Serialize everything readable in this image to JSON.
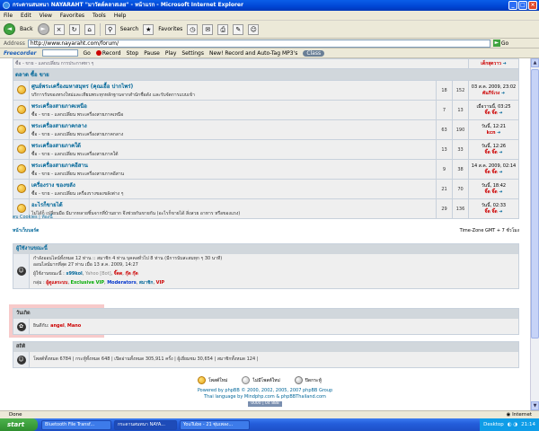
{
  "window": {
    "title": "กระดานสนทนา NAYARAHT \"มาวัตต์คลาสเลย\" - หน้าแรก - Microsoft Internet Explorer",
    "buttons": [
      "_",
      "□",
      "×"
    ]
  },
  "menu": [
    "File",
    "Edit",
    "View",
    "Favorites",
    "Tools",
    "Help"
  ],
  "toolbar": {
    "back": "Back",
    "search": "Search",
    "favorites": "Favorites"
  },
  "address": {
    "label": "Address",
    "url": "http://www.nayaraht.com/forum/",
    "go": "Go"
  },
  "linksbar": {
    "brand": "Freecorder",
    "go": "Go",
    "record": "Record",
    "stop": "Stop",
    "pause": "Pause",
    "play": "Play",
    "settings": "Settings",
    "new_record": "New! Record and Auto-Tag MP3's",
    "class_label": "Class"
  },
  "forum": {
    "cut_row": "ซื้อ - ขาย - แลกเปลี่ยน การประกาศหา ๆ",
    "cut_row_user": "เด็กสุดวาว",
    "category": "ตลาด ซื้อ ขาย",
    "rows": [
      {
        "name": "ศูนย์พระเครื่องมหาสมุทร (คุณเอื้อ ปากไพร่)",
        "desc": "บริการรับของทรงใหม่และเทียมพระทุกหลักฐานจากสำนักชื่อดัง และรับจัดการแบบเข้า",
        "topics": "18",
        "posts": "152",
        "date": "03 ส.ค. 2009, 23:02",
        "user": "คัมภีร์เรง"
      },
      {
        "name": "พระเครื่องสายภาคเหนือ",
        "desc": "ซื้อ - ขาย - แลกเปลี่ยน พระเครื่องสายภาคเหนือ",
        "topics": "7",
        "posts": "13",
        "date": "เมื่อวานนี้, 03:25",
        "user": "จิ๊ด จิ๊ด"
      },
      {
        "name": "พระเครื่องสายภาคกลาง",
        "desc": "ซื้อ - ขาย - แลกเปลี่ยน พระเครื่องสายภาคกลาง",
        "topics": "63",
        "posts": "190",
        "date": "วันนี้, 12:21",
        "user": "kcn"
      },
      {
        "name": "พระเครื่องสายภาคใต้",
        "desc": "ซื้อ - ขาย - แลกเปลี่ยน พระเครื่องสายภาคใต้",
        "topics": "13",
        "posts": "33",
        "date": "วันนี้, 12:26",
        "user": "จิ๊ด จิ๊ด"
      },
      {
        "name": "พระเครื่องสายภาคอีสาน",
        "desc": "ซื้อ - ขาย - แลกเปลี่ยน พระเครื่องสายภาคอีสาน",
        "topics": "9",
        "posts": "38",
        "date": "14 ส.ค. 2009, 02:14",
        "user": "จิ๊ด จิ๊ด"
      },
      {
        "name": "เครื่องราง ของขลัง",
        "desc": "ซื้อ - ขาย - แลกเปลี่ยน เครื่องรางของขลังต่าง ๆ",
        "topics": "21",
        "posts": "70",
        "date": "วันนี้, 18:42",
        "user": "จิ๊ด จิ๊ด"
      },
      {
        "name": "อะไรก็ขายได้",
        "desc": "ไม่ได้ก็ เปลี่ยนมือ มีมากหลายชิ้นจากที่บ้านยาก จึงช่วยกันขายกัน (อะไรก็ขายได้ สิ่งสวย อาหาร หรือของแรง)",
        "topics": "29",
        "posts": "136",
        "date": "วันนี้, 02:33",
        "user": "จิ๊ด จิ๊ด"
      }
    ],
    "below_link": "ตบ Cookies | ห้องนี้",
    "timezone_left": "หน้าเว็บบอร์ด",
    "timezone_right": "Time-Zone GMT + 7 ชั่วโมง"
  },
  "who_online": {
    "title": "ผู้ใช้งานขณะนี้",
    "line1": "กำลังออนไลน์ทั้งหมด 12 ท่าน :: สมาชิก 4 ท่าน บุคคลทั่วไป 8 ท่าน (มีการนับสะสมทุก ๆ 30 นาที)",
    "line2": "ออนไลน์มากที่สุด 27 ท่าน เมื่อ 13 ส.ค. 2009, 14:27",
    "users_label": "ผู้ใช้งานขณะนี้ :",
    "users": [
      "s99kol",
      "Yahoo [Bot]",
      "จิ๊ดด",
      "กุ๊ด กุ๊ด"
    ],
    "groups_label": "กลุ่ม :",
    "groups": [
      "ผู้ดูแลระบบ",
      "Exclusive VIP",
      "Moderators",
      "สมาชิก",
      "VIP"
    ]
  },
  "birthday": {
    "title": "วันเกิด",
    "label": "ยินดีกับ:",
    "names": [
      "angel",
      "Mano"
    ]
  },
  "stats": {
    "title": "สถิติ",
    "line": "โพสต์ทั้งหมด 6784 | กระทู้ทั้งหมด 648 | เปิดอ่านทั้งหมด 305,911 ครั้ง | ผู้เยี่ยมชม 30,654 | สมาชิกทั้งหมด 124 |"
  },
  "legend": {
    "new": "โพสต์ใหม่",
    "none": "ไม่มีโพสต์ใหม่",
    "locked": "ปิดกระทู้"
  },
  "footer": {
    "line1": "Powered by phpBB © 2000, 2002, 2005, 2007 phpBB Group",
    "line2": "Thai language by Mindphp.com & phpBBThailand.com",
    "counter": "0000 | 04 888"
  },
  "statusbar": {
    "left": "Done",
    "right": "Internet"
  },
  "taskbar": {
    "start": "start",
    "tasks": [
      "Bluetooth File Transf...",
      "กระดานสนทนา NAYA...",
      "YouTube - 21 ซุ่มเพลง..."
    ],
    "desktop": "Desktop",
    "time": "21:14"
  }
}
